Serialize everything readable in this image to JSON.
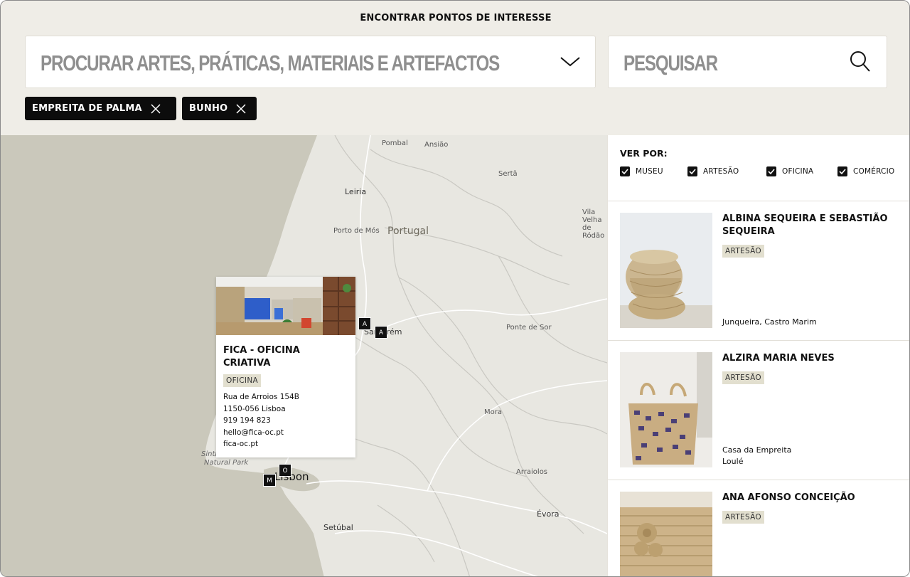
{
  "header": {
    "title": "ENCONTRAR PONTOS DE INTERESSE",
    "category_placeholder": "PROCURAR ARTES, PRÁTICAS, MATERIAIS E ARTEFACTOS",
    "search_placeholder": "PESQUISAR"
  },
  "active_filters": [
    {
      "label": "EMPREITA DE PALMA"
    },
    {
      "label": "BUNHO"
    }
  ],
  "map": {
    "country_label": "Portugal",
    "places": [
      "Pombal",
      "Ansião",
      "Sertã",
      "Leiria",
      "Porto de Mós",
      "Vila Velha de Ródão",
      "Santarém",
      "Ponte de Sor",
      "Mora",
      "Arraiolos",
      "Évora",
      "Setúbal",
      "Lisbon",
      "Sintra",
      "Natural Park"
    ],
    "markers": [
      "A",
      "A",
      "O",
      "M"
    ],
    "popup": {
      "title": "FICA - OFICINA CRIATIVA",
      "tag": "OFICINA",
      "address_1": "Rua de Arroios 154B",
      "address_2": "1150-056 Lisboa",
      "phone": "919 194 823",
      "email": "hello@fica-oc.pt",
      "website": "fica-oc.pt"
    }
  },
  "panel": {
    "view_by_label": "VER POR:",
    "filters": [
      {
        "label": "MUSEU",
        "checked": true
      },
      {
        "label": "ARTESÃO",
        "checked": true
      },
      {
        "label": "OFICINA",
        "checked": true
      },
      {
        "label": "COMÉRCIO",
        "checked": true
      }
    ],
    "results": [
      {
        "name": "ALBINA SEQUEIRA E SEBASTIÃO SEQUEIRA",
        "tag": "ARTESÃO",
        "location_1": "Junqueira, Castro Marim",
        "location_2": ""
      },
      {
        "name": "ALZIRA MARIA NEVES",
        "tag": "ARTESÃO",
        "location_1": "Casa da Empreita",
        "location_2": "Loulé"
      },
      {
        "name": "ANA AFONSO CONCEIÇÃO",
        "tag": "ARTESÃO",
        "location_1": "",
        "location_2": ""
      }
    ]
  },
  "colors": {
    "background": "#efede7",
    "chip": "#0c0c0c",
    "tag": "#e2dfcf",
    "ocean": "#cac8bb",
    "land": "#e8e7e1"
  }
}
